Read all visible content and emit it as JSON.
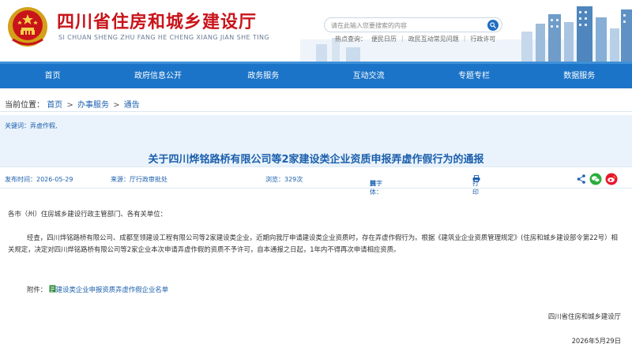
{
  "header": {
    "site_title": "四川省住房和城乡建设厅",
    "site_pinyin": "SI CHUAN SHENG ZHU FANG HE CHENG XIANG JIAN SHE TING",
    "search_placeholder": "请在此输入您要搜索的内容",
    "hot_label": "热点查询：",
    "hot_links": [
      "便民日历",
      "政民互动常见问题",
      "行政许可"
    ]
  },
  "nav": {
    "items": [
      "首页",
      "政府信息公开",
      "政务服务",
      "互动交流",
      "专题专栏",
      "数据服务"
    ]
  },
  "breadcrumb": {
    "label": "当前位置：",
    "items": [
      "首页",
      "办事服务",
      "通告"
    ],
    "arrow": ">"
  },
  "article": {
    "keywords": "关键词：弄虚作假,",
    "title": "关于四川烨铭路桥有限公司等2家建设类企业资质申报弄虚作假行为的通报",
    "meta": {
      "date": "发布时间：2026-05-29",
      "source": "来源：厅行政审批处",
      "views": "浏览：329次",
      "font_label": "【字体：",
      "font_sizes": [
        "大",
        "中",
        "小"
      ],
      "font_close": "】",
      "print": "打印"
    },
    "salutation": "各市（州）住房城乡建设行政主管部门、各有关单位：",
    "paragraph": "经查，四川烨铭路桥有限公司、成都至领建设工程有限公司等2家建设类企业，近期向我厅申请建设类企业资质时，存在弄虚作假行为。根据《建筑业企业资质管理规定》(住房和城乡建设部令第22号）相关规定，决定对四川烨铭路桥有限公司等2家企业本次申请弄虚作假的资质不予许可，自本通报之日起，1年内不得再次申请相应资质。",
    "attachment_label": "附件：",
    "attachment_link": "建设类企业申报资质弄虚作假企业名单",
    "signature": "四川省住房和城乡建设厅",
    "sign_date": "2026年5月29日"
  },
  "colors": {
    "brand_red": "#c8141a",
    "nav_blue": "#1b74c8",
    "link_blue": "#1b5fad"
  },
  "icons": [
    "national-emblem",
    "search-icon",
    "print-icon",
    "share-icon",
    "wechat-icon",
    "weibo-icon",
    "attachment-icon"
  ]
}
